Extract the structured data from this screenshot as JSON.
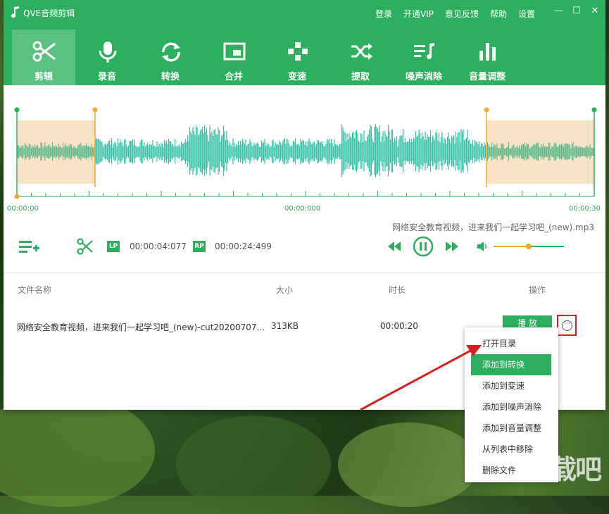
{
  "app": {
    "title": "QVE音频剪辑",
    "top_links": [
      "登录",
      "开通VIP",
      "意见反馈",
      "帮助",
      "设置"
    ],
    "window_controls": [
      "—",
      "☐",
      "✕"
    ]
  },
  "tabs": [
    {
      "label": "剪辑",
      "icon": "scissors-icon",
      "active": true
    },
    {
      "label": "录音",
      "icon": "microphone-icon"
    },
    {
      "label": "转换",
      "icon": "refresh-icon"
    },
    {
      "label": "合并",
      "icon": "merge-icon"
    },
    {
      "label": "变速",
      "icon": "gamepad-icon"
    },
    {
      "label": "提取",
      "icon": "shuffle-icon"
    },
    {
      "label": "噪声消除",
      "icon": "music-list-icon"
    },
    {
      "label": "音量调整",
      "icon": "bars-icon"
    }
  ],
  "timeline": {
    "start": "00:00:00",
    "middle": "00:00:000",
    "end": "00:00:30"
  },
  "current_file": "网络安全教育视频，进来我们一起学习吧_(new).mp3",
  "controls": {
    "lp_badge": "LP",
    "lp_time": "00:00:04:077",
    "rp_badge": "RP",
    "rp_time": "00:00:24:499",
    "volume": 0.5
  },
  "list": {
    "headers": [
      "文件名称",
      "大小",
      "时长",
      "操作"
    ],
    "rows": [
      {
        "name": "网络安全教育视频，进来我们一起学习吧_(new)-cut20200707...",
        "size": "313KB",
        "duration": "00:00:20",
        "action": "播 放"
      }
    ]
  },
  "context_menu": [
    "打开目录",
    "添加到转换",
    "添加到变速",
    "添加到噪声消除",
    "添加到音量调整",
    "从列表中移除",
    "删除文件"
  ],
  "colors": {
    "brand": "#2db05e",
    "wave": "#36c0a6",
    "selection": "#fae3c4",
    "marker": "#f2a934",
    "arrow": "#d62020"
  },
  "watermark": "下载吧"
}
